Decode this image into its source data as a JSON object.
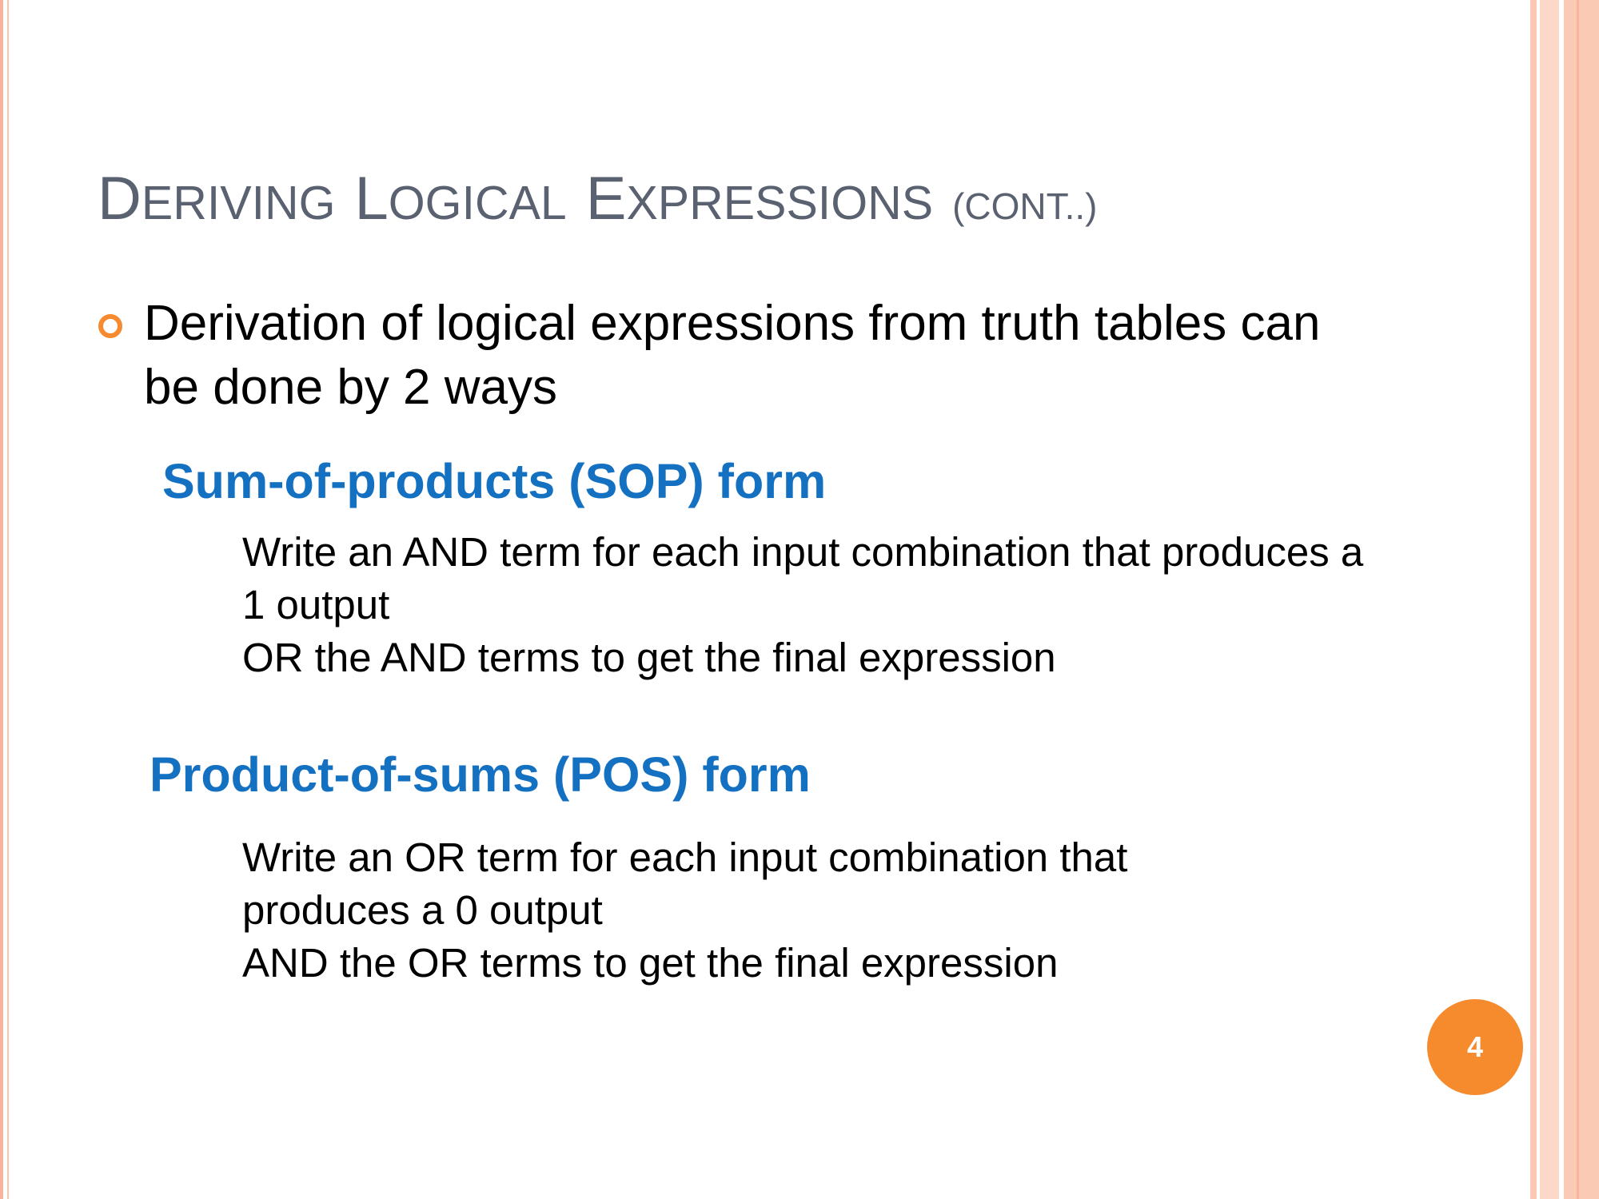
{
  "title": {
    "word1_cap": "D",
    "word1_rest": "ERIVING",
    "word2_cap": "L",
    "word2_rest": "OGICAL",
    "word3_cap": "E",
    "word3_rest": "XPRESSIONS",
    "suffix": "(CONT..)"
  },
  "bullet": {
    "line1": "Derivation of logical expressions from truth tables can",
    "line2": "be done by 2 ways"
  },
  "sop": {
    "heading": "Sum-of-products (SOP) form",
    "line1": "Write an AND term for each input combination that produces a",
    "line2": "1 output",
    "line3": "OR the AND terms to get the final expression"
  },
  "pos": {
    "heading": "Product-of-sums (POS) form",
    "line1": "Write an OR term for each input combination that",
    "line2": "produces a 0 output",
    "line3": "AND the OR terms to get the final expression"
  },
  "page_number": "4",
  "colors": {
    "title": "#5a6272",
    "heading": "#1470c0",
    "accent": "#f68b2e",
    "border": "#fbcab5"
  }
}
